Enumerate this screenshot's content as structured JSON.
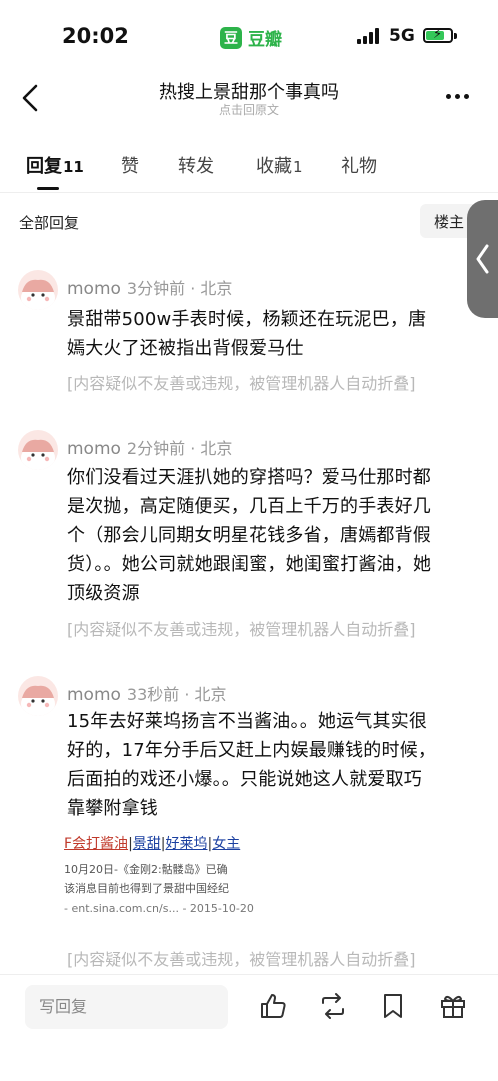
{
  "status_bar": {
    "time": "20:02",
    "app_badge": "豆",
    "app_name": "豆瓣",
    "network": "5G"
  },
  "header": {
    "title": "热搜上景甜那个事真吗",
    "subtitle": "点击回原文"
  },
  "tabs": [
    {
      "label": "回复",
      "count": "11",
      "active": true
    },
    {
      "label": "赞",
      "count": ""
    },
    {
      "label": "转发",
      "count": ""
    },
    {
      "label": "收藏",
      "count": "1"
    },
    {
      "label": "礼物",
      "count": ""
    }
  ],
  "sort": {
    "all_label": "全部回复",
    "owner_label": "楼主"
  },
  "comments": [
    {
      "author": "momo",
      "time": "3分钟前 · 北京",
      "lines": [
        "景甜带500w手表时候，杨颖还在玩泥巴，唐",
        "嫣大火了还被指出背假爱马仕"
      ],
      "folded": "[内容疑似不友善或违规，被管理机器人自动折叠]"
    },
    {
      "author": "momo",
      "time": "2分钟前 · 北京",
      "lines": [
        "你们没看过天涯扒她的穿搭吗？爱马仕那时都",
        "是次抛，高定随便买，几百上千万的手表好几",
        "个（那会儿同期女明星花钱多省，唐嫣都背假",
        "货）。。她公司就她跟闺蜜，她闺蜜打酱油，她",
        "顶级资源"
      ],
      "folded": "[内容疑似不友善或违规，被管理机器人自动折叠]"
    },
    {
      "author": "momo",
      "time": "33秒前 · 北京",
      "lines": [
        "15年去好莱坞扬言不当酱油。。她运气其实很",
        "好的，17年分手后又赶上内娱最赚钱的时候，",
        "后面拍的戏还小爆。。只能说她这人就爱取巧",
        "靠攀附拿钱"
      ],
      "folded": "[内容疑似不友善或违规，被管理机器人自动折叠]"
    }
  ],
  "link_preview": {
    "tag1": "F会打酱油",
    "tag2": "景甜",
    "tag3": "好莱坞",
    "tag4": "女主",
    "line2": "10月20日-《金刚2:骷髅岛》已确",
    "line3": "该消息目前也得到了景甜中国经纪",
    "line4": "- ent.sina.com.cn/s... - 2015-10-20"
  },
  "bottom_bar": {
    "reply_placeholder": "写回复"
  },
  "icons": {
    "back": "chevron-left-icon",
    "more": "more-icon",
    "like": "thumbs-up-icon",
    "repost": "repost-icon",
    "bookmark": "bookmark-icon",
    "gift": "gift-icon",
    "side": "chevron-left-icon"
  },
  "colors": {
    "brand_green": "#2db34a",
    "avatar_bg": "#fbe7e4",
    "folded_text": "#b8b8b8"
  }
}
